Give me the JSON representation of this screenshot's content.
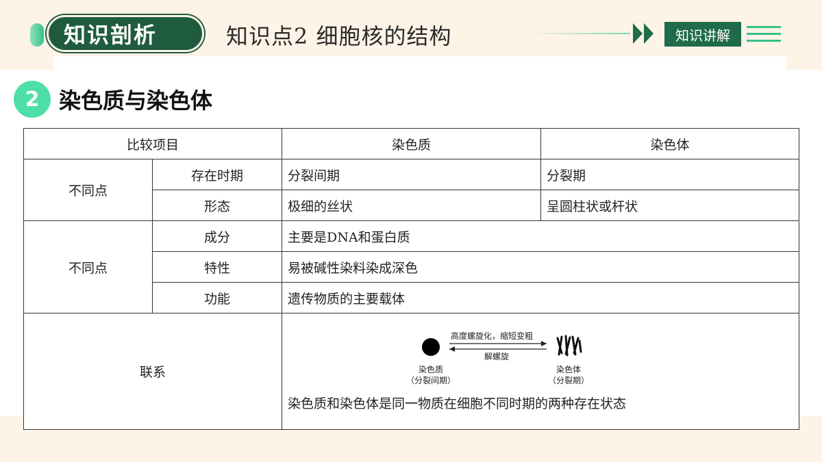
{
  "header": {
    "section_label": "知识剖析",
    "title": "知识点2  细胞核的结构",
    "badge": "知识讲解"
  },
  "section": {
    "number": "2",
    "title": "染色质与染色体"
  },
  "table": {
    "headers": [
      "比较项目",
      "染色质",
      "染色体"
    ],
    "differences_label": "不同点",
    "rows_diff": [
      {
        "item": "存在时期",
        "chromatin": "分裂间期",
        "chromosome": "分裂期"
      },
      {
        "item": "形态",
        "chromatin": "极细的丝状",
        "chromosome": "呈圆柱状或杆状"
      }
    ],
    "similarities_label": "不同点",
    "rows_same": [
      {
        "item": "成分",
        "value": "主要是DNA和蛋白质"
      },
      {
        "item": "特性",
        "value": "易被碱性染料染成深色"
      },
      {
        "item": "功能",
        "value": "遗传物质的主要载体"
      }
    ],
    "relation_label": "联系",
    "relation_text": "染色质和染色体是同一物质在细胞不同时期的两种存在状态",
    "diagram": {
      "arrow_top": "高度螺旋化，缩短变粗",
      "arrow_bottom": "解螺旋",
      "left_caption_1": "染色质",
      "left_caption_2": "（分裂间期）",
      "right_caption_1": "染色体",
      "right_caption_2": "（分裂期）"
    }
  },
  "colors": {
    "dark_green": "#1f5c3f",
    "accent_green": "#4ddfa7",
    "background": "#fdf3e6"
  }
}
